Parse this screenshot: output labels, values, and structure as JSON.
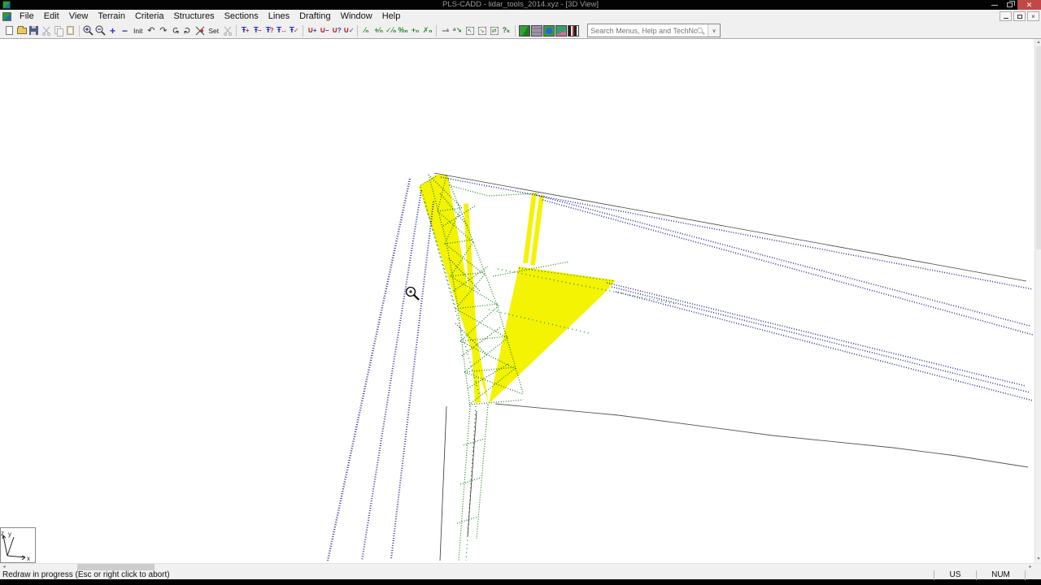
{
  "window": {
    "title": "PLS-CADD - lidar_tools_2014.xyz - [3D View]"
  },
  "menu": {
    "items": [
      {
        "label": "File"
      },
      {
        "label": "Edit"
      },
      {
        "label": "View"
      },
      {
        "label": "Terrain"
      },
      {
        "label": "Criteria"
      },
      {
        "label": "Structures"
      },
      {
        "label": "Sections"
      },
      {
        "label": "Lines"
      },
      {
        "label": "Drafting"
      },
      {
        "label": "Window"
      },
      {
        "label": "Help"
      }
    ]
  },
  "toolbar": {
    "init_label": "Init",
    "set_label": "Set",
    "search": {
      "placeholder": "Search Menus, Help and TechNotes"
    },
    "icon_names": [
      "new-file",
      "open-file",
      "save-file",
      "cut",
      "copy",
      "paste",
      "zoom-in",
      "zoom-out",
      "increase",
      "decrease",
      "init-view",
      "rotate-left",
      "rotate-right",
      "rotate-up",
      "rotate-down",
      "set-rotation-origin",
      "set-view",
      "clip",
      "add-structure",
      "delete-structure",
      "structure-info",
      "move-structure",
      "check-structure",
      "add-section",
      "delete-section",
      "section-info",
      "check-section",
      "section-modify-1",
      "section-modify-2",
      "section-modify-3",
      "section-modify-4",
      "section-modify-5",
      "section-modify-6",
      "label-underline",
      "label-leader",
      "move-label-in",
      "move-label-out",
      "swap-label",
      "label-help",
      "view-3d",
      "view-pp",
      "view-plan",
      "view-profile",
      "view-schematic"
    ]
  },
  "viewport": {
    "axis_labels": {
      "x": "x",
      "y": "y",
      "z": "z"
    },
    "colors": {
      "point_cloud_structure": "#1b7c1b",
      "conductor_points": "#32329c",
      "clearance_highlight": "#f3f303",
      "terrain_line": "#555555"
    },
    "cursor": "zoom-magnifier"
  },
  "status": {
    "message": "Redraw in progress (Esc or right click to abort)",
    "keyboard_layout": "US",
    "numlock": "NUM"
  }
}
